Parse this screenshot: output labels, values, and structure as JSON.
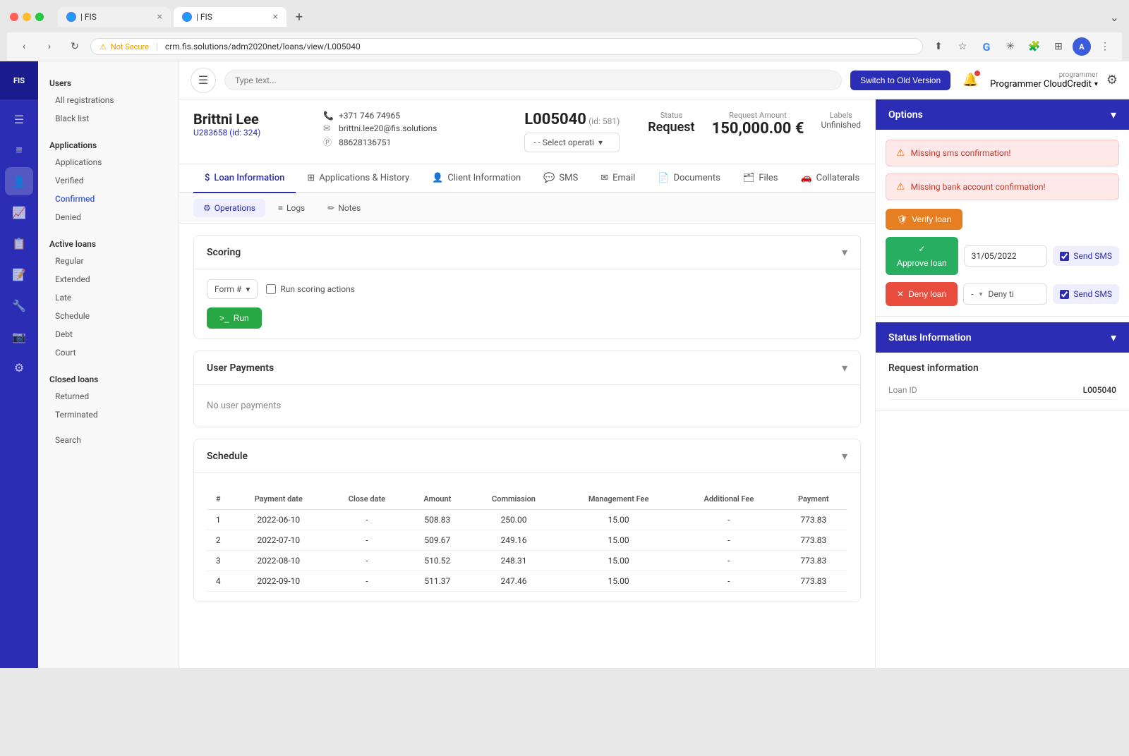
{
  "browser": {
    "tabs": [
      {
        "label": "| FIS",
        "active": false
      },
      {
        "label": "| FIS",
        "active": true
      }
    ],
    "address": "crm.fis.solutions/adm2020net/loans/view/L005040",
    "security_label": "Not Secure"
  },
  "header": {
    "search_placeholder": "Type text...",
    "switch_version_label": "Switch to Old Version",
    "user_role": "programmer",
    "user_name": "Programmer CloudCredit",
    "settings_label": "Settings"
  },
  "sidebar": {
    "logo": "FIS",
    "sections": [
      {
        "title": "Users",
        "items": [
          "All registrations",
          "Black list"
        ]
      },
      {
        "title": "Applications",
        "items": [
          "Applications",
          "Verified",
          "Confirmed",
          "Denied"
        ]
      },
      {
        "title": "Active loans",
        "items": [
          "Regular",
          "Extended",
          "Late",
          "Schedule",
          "Debt",
          "Court"
        ]
      },
      {
        "title": "Closed loans",
        "items": [
          "Returned",
          "Terminated"
        ]
      },
      {
        "title": "",
        "items": [
          "Search"
        ]
      }
    ]
  },
  "client": {
    "name": "Brittni Lee",
    "id": "U283658 (id: 324)",
    "phone": "+371 746 74965",
    "email": "brittni.lee20@fis.solutions",
    "payment_id": "88628136751",
    "loan_id": "L005040",
    "loan_id_small": "(id: 581)",
    "select_operation_placeholder": "- - Select operati",
    "status_label": "Status",
    "status_value": "Request",
    "request_amount_label": "Request Amount",
    "request_amount_value": "150,000.00 €",
    "labels_label": "Labels",
    "labels_value": "Unfinished"
  },
  "tabs_primary": [
    {
      "label": "Loan Information",
      "icon": "$",
      "active": true
    },
    {
      "label": "Applications & History",
      "icon": "⊞",
      "active": false
    },
    {
      "label": "Client Information",
      "icon": "👤",
      "active": false
    },
    {
      "label": "SMS",
      "icon": "💬",
      "active": false
    },
    {
      "label": "Email",
      "icon": "✉",
      "active": false
    },
    {
      "label": "Documents",
      "icon": "📄",
      "active": false
    },
    {
      "label": "Files",
      "icon": "🗂",
      "active": false
    },
    {
      "label": "Collaterals",
      "icon": "🚗",
      "active": false
    }
  ],
  "tabs_secondary": [
    {
      "label": "Operations",
      "icon": "⚙",
      "active": true
    },
    {
      "label": "Logs",
      "icon": "≡",
      "active": false
    },
    {
      "label": "Notes",
      "icon": "✏",
      "active": false
    }
  ],
  "scoring": {
    "title": "Scoring",
    "form_label": "Form #",
    "run_scoring_label": "Run scoring actions",
    "run_btn_label": "Run"
  },
  "user_payments": {
    "title": "User Payments",
    "no_payments_text": "No user payments"
  },
  "schedule": {
    "title": "Schedule",
    "columns": [
      "#",
      "Payment date",
      "Close date",
      "Amount",
      "Commission",
      "Management Fee",
      "Additional Fee",
      "Payment"
    ],
    "rows": [
      {
        "num": "1",
        "payment_date": "2022-06-10",
        "close_date": "-",
        "amount": "508.83",
        "commission": "250.00",
        "mgmt_fee": "15.00",
        "additional_fee": "-",
        "payment": "773.83"
      },
      {
        "num": "2",
        "payment_date": "2022-07-10",
        "close_date": "-",
        "amount": "509.67",
        "commission": "249.16",
        "mgmt_fee": "15.00",
        "additional_fee": "-",
        "payment": "773.83"
      },
      {
        "num": "3",
        "payment_date": "2022-08-10",
        "close_date": "-",
        "amount": "510.52",
        "commission": "248.31",
        "mgmt_fee": "15.00",
        "additional_fee": "-",
        "payment": "773.83"
      },
      {
        "num": "4",
        "payment_date": "2022-09-10",
        "close_date": "-",
        "amount": "511.37",
        "commission": "247.46",
        "mgmt_fee": "15.00",
        "additional_fee": "-",
        "payment": "773.83"
      }
    ]
  },
  "options_panel": {
    "title": "Options",
    "alerts": [
      {
        "message": "Missing sms confirmation!"
      },
      {
        "message": "Missing bank account confirmation!"
      }
    ],
    "verify_btn_label": "Verify loan",
    "approve_btn_label": "Approve\nloan",
    "approve_date": "31/05/2022",
    "send_sms_approve_label": "Send SMS",
    "deny_btn_label": "Deny loan",
    "deny_placeholder": "Deny ti",
    "send_sms_deny_label": "Send SMS"
  },
  "status_panel": {
    "title": "Status Information",
    "request_info_title": "Request information",
    "loan_id_label": "Loan ID",
    "loan_id_value": "L005040"
  }
}
